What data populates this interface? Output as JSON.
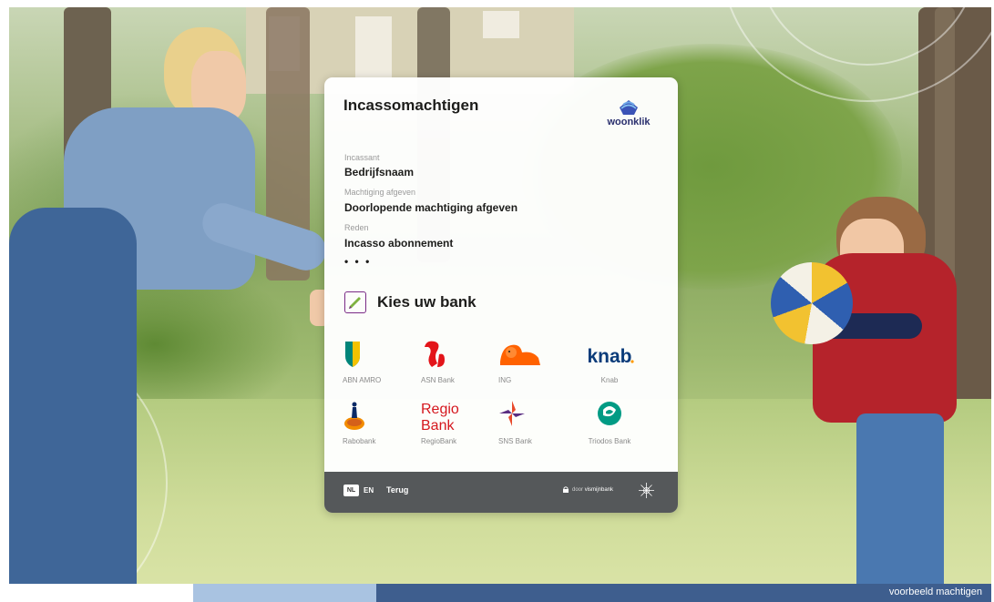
{
  "card": {
    "title": "Incassomachtigen",
    "logo_text": "woonklik",
    "fields": [
      {
        "label": "Incassant",
        "value": "Bedrijfsnaam"
      },
      {
        "label": "Machtiging afgeven",
        "value": "Doorlopende machtiging afgeven"
      },
      {
        "label": "Reden",
        "value": "Incasso abonnement"
      }
    ],
    "ellipsis": "• • •",
    "choose_bank": "Kies uw bank",
    "banks": [
      {
        "name": "ABN AMRO",
        "icon": "abn-amro-shield-icon",
        "color": "#00857a"
      },
      {
        "name": "ASN Bank",
        "icon": "asn-squirrel-icon",
        "color": "#e3151a"
      },
      {
        "name": "ING",
        "icon": "ing-lion-icon",
        "color": "#ff6200"
      },
      {
        "name": "Knab",
        "logo_text": "knab",
        "color": "#0b3c7a"
      },
      {
        "name": "Rabobank",
        "icon": "rabobank-figure-icon",
        "color": "#f28c00"
      },
      {
        "name": "RegioBank",
        "logo_line1": "Regio",
        "logo_line2": "Bank",
        "color": "#d5171e"
      },
      {
        "name": "SNS Bank",
        "icon": "sns-star-icon",
        "color": "#5a2d82"
      },
      {
        "name": "Triodos Bank",
        "icon": "triodos-knot-icon",
        "color": "#009b84"
      }
    ]
  },
  "footer": {
    "lang_active": "NL",
    "lang_other": "EN",
    "back": "Terug",
    "powered_prefix": "door ",
    "powered_brand": "vismijnbank"
  },
  "bottom_bar": {
    "caption": "voorbeeld machtigen",
    "colors": [
      "#ffffff",
      "#a9c3e1",
      "#3e5e8e"
    ]
  }
}
